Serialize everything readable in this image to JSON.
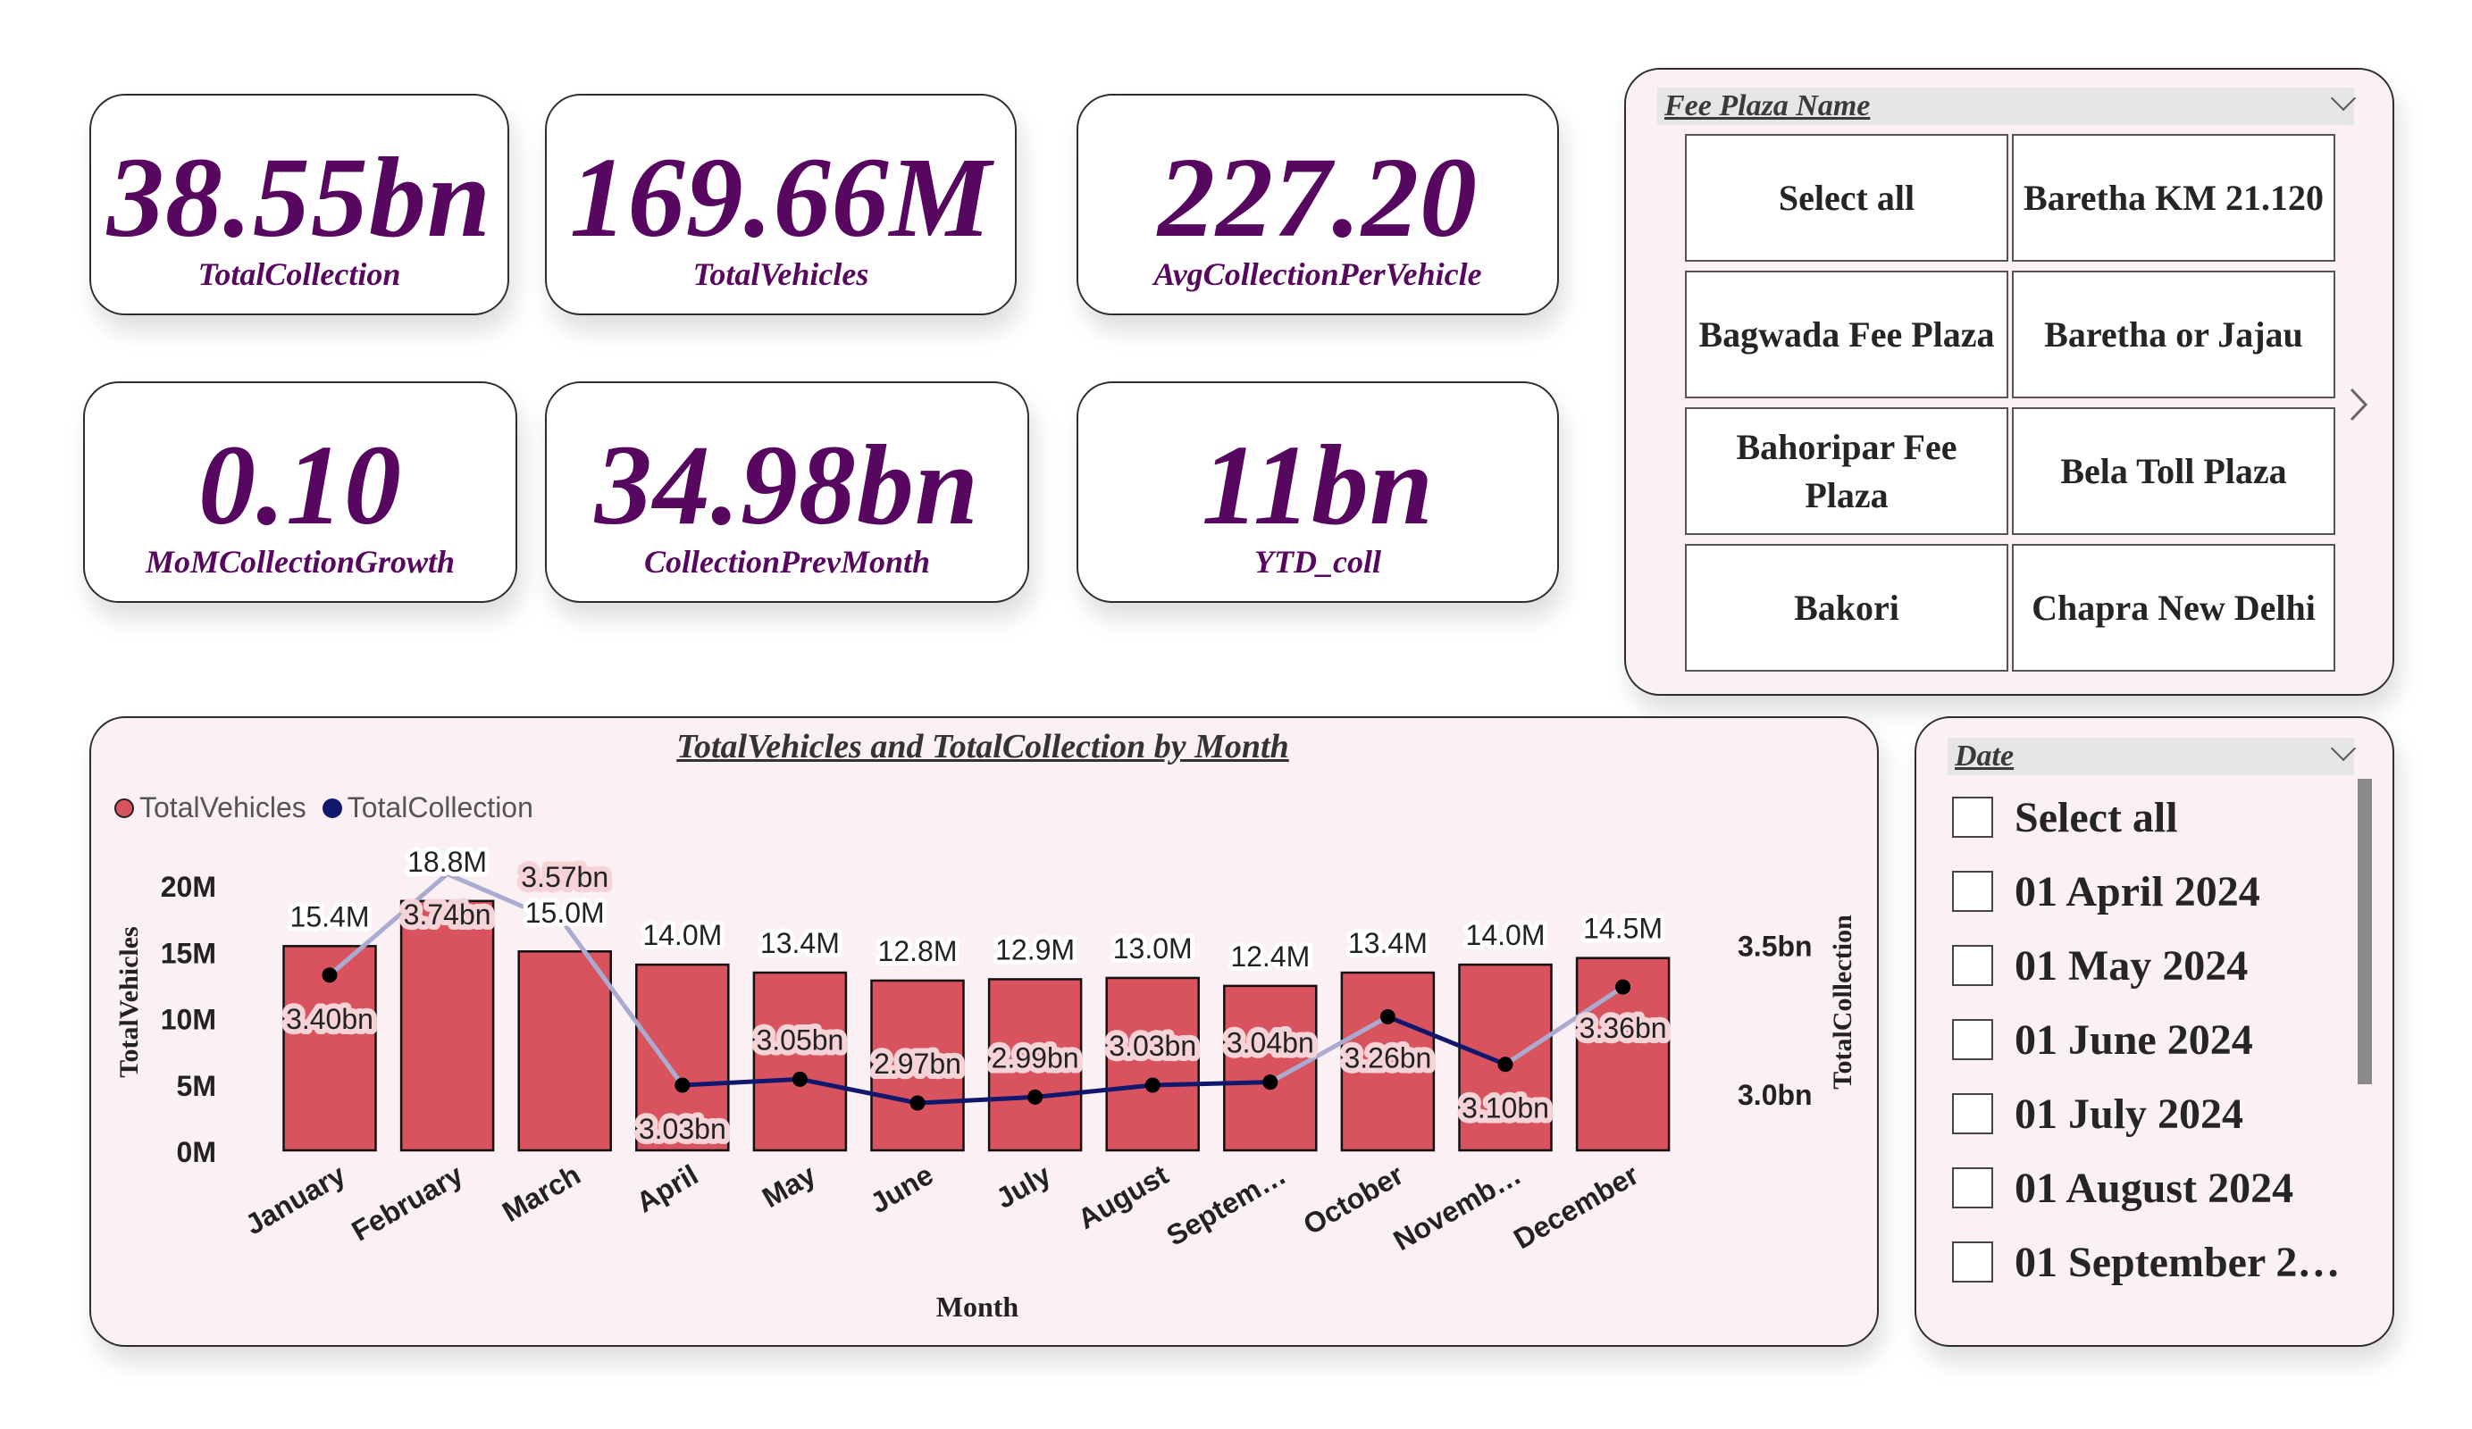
{
  "kpis": [
    {
      "value": "38.55bn",
      "label": "TotalCollection"
    },
    {
      "value": "169.66M",
      "label": "TotalVehicles"
    },
    {
      "value": "227.20",
      "label": "AvgCollectionPerVehicle"
    },
    {
      "value": "0.10",
      "label": "MoMCollectionGrowth"
    },
    {
      "value": "34.98bn",
      "label": "CollectionPrevMonth"
    },
    {
      "value": "11bn",
      "label": "YTD_coll"
    }
  ],
  "fee_plaza_slicer": {
    "title": "Fee Plaza Name",
    "items": [
      "Select all",
      "Baretha KM 21.120",
      "Bagwada Fee Plaza",
      "Baretha or Jajau",
      "Bahoripar Fee Plaza",
      "Bela Toll Plaza",
      "Bakori",
      "Chapra New Delhi"
    ]
  },
  "date_slicer": {
    "title": "Date",
    "items": [
      "Select all",
      "01 April 2024",
      "01 May 2024",
      "01 June 2024",
      "01 July 2024",
      "01 August 2024",
      "01 September 2…"
    ]
  },
  "colors": {
    "accent": "#57075f",
    "bar": "#d9535e",
    "line": "#12176e",
    "panel_bg": "#fbf0f4"
  },
  "chart_data": {
    "type": "bar",
    "title": "TotalVehicles and TotalCollection by Month",
    "xlabel": "Month",
    "ylabel": "TotalVehicles",
    "y2label": "TotalCollection",
    "categories": [
      "January",
      "February",
      "March",
      "April",
      "May",
      "June",
      "July",
      "August",
      "Septem…",
      "October",
      "Novemb…",
      "December"
    ],
    "legend": [
      "TotalVehicles",
      "TotalCollection"
    ],
    "yticks": [
      "0M",
      "5M",
      "10M",
      "15M",
      "20M"
    ],
    "y2ticks": [
      "3.0bn",
      "3.5bn"
    ],
    "series": [
      {
        "name": "TotalVehicles",
        "type": "bar",
        "values": [
          15.4,
          18.8,
          15.0,
          14.0,
          13.4,
          12.8,
          12.9,
          13.0,
          12.4,
          13.4,
          14.0,
          14.5
        ],
        "labels": [
          "15.4M",
          "18.8M",
          "15.0M",
          "14.0M",
          "13.4M",
          "12.8M",
          "12.9M",
          "13.0M",
          "12.4M",
          "13.4M",
          "14.0M",
          "14.5M"
        ]
      },
      {
        "name": "TotalCollection",
        "type": "line",
        "values": [
          3.4,
          3.74,
          3.57,
          3.03,
          3.05,
          2.97,
          2.99,
          3.03,
          3.04,
          3.26,
          3.1,
          3.36
        ],
        "labels": [
          "3.40bn",
          "3.74bn",
          "3.57bn",
          "3.03bn",
          "3.05bn",
          "2.97bn",
          "2.99bn",
          "3.03bn",
          "3.04bn",
          "3.26bn",
          "3.10bn",
          "3.36bn"
        ]
      }
    ],
    "ylim": [
      0,
      20
    ],
    "legend_position": "top-left"
  }
}
